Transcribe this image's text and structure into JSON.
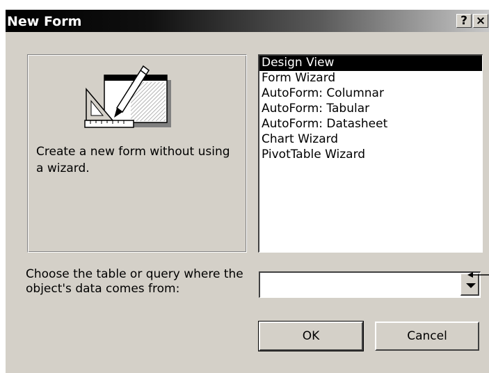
{
  "window": {
    "title": "New Form",
    "help_label": "?",
    "close_label": "×"
  },
  "preview": {
    "icon": "form-design-icon",
    "description": "Create a new form without using a wizard."
  },
  "wizard_list": {
    "items": [
      "Design View",
      "Form Wizard",
      "AutoForm:  Columnar",
      "AutoForm:  Tabular",
      "AutoForm:  Datasheet",
      "Chart Wizard",
      "PivotTable Wizard"
    ],
    "selected": "Design View"
  },
  "source": {
    "label": "Choose the table or query where the object's data comes from:",
    "value": ""
  },
  "buttons": {
    "ok": "OK",
    "cancel": "Cancel"
  },
  "colors": {
    "dialog_face": "#d4d0c8",
    "selection": "#000000",
    "title_text": "#ffffff"
  }
}
